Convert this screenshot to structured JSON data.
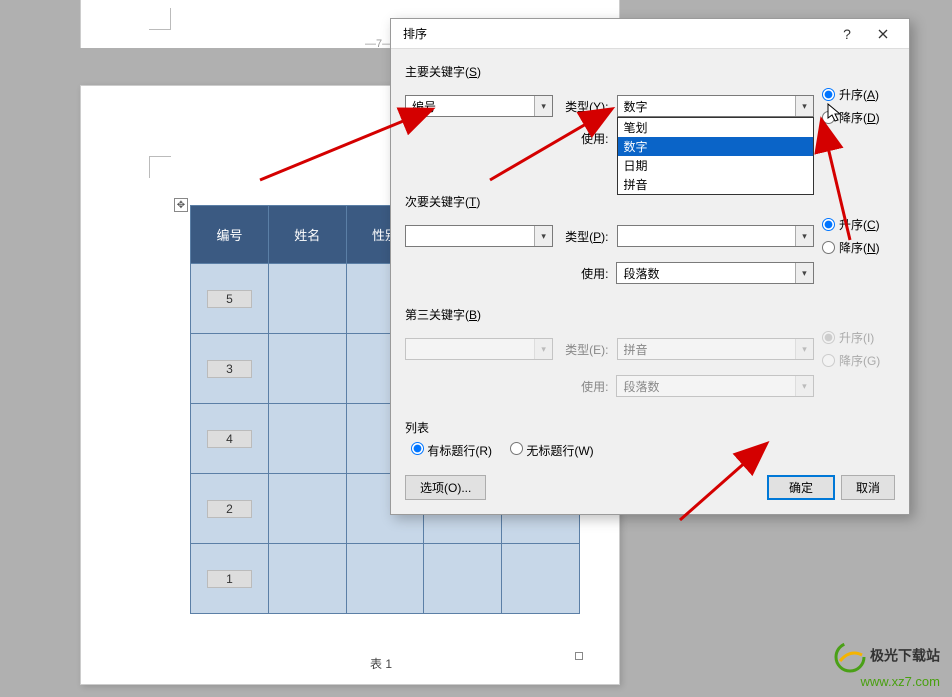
{
  "page_gap": "—7—",
  "table": {
    "headers": [
      "编号",
      "姓名",
      "性别",
      "",
      ""
    ],
    "rows": [
      [
        "5",
        "",
        "",
        "",
        ""
      ],
      [
        "3",
        "",
        "",
        "",
        ""
      ],
      [
        "4",
        "",
        "",
        "",
        ""
      ],
      [
        "2",
        "",
        "",
        "",
        ""
      ],
      [
        "1",
        "",
        "",
        "",
        ""
      ]
    ],
    "caption": "表 1"
  },
  "dialog": {
    "title": "排序",
    "section1": {
      "label_prefix": "主要关键字(",
      "label_hotkey": "S",
      "label_suffix": ")",
      "key_value": "编号",
      "type_label_prefix": "类型(",
      "type_hotkey": "Y",
      "type_label_suffix": "):",
      "type_value": "数字",
      "type_options": [
        "笔划",
        "数字",
        "日期",
        "拼音"
      ],
      "use_label": "使用:",
      "asc_label": "升序(A)",
      "desc_label": "降序(D)"
    },
    "section2": {
      "label_prefix": "次要关键字(",
      "label_hotkey": "T",
      "label_suffix": ")",
      "key_value": "",
      "type_label_prefix": "类型(",
      "type_hotkey": "P",
      "type_label_suffix": "):",
      "type_value": "",
      "use_label": "使用:",
      "use_value": "段落数",
      "asc_label": "升序(C)",
      "desc_label": "降序(N)"
    },
    "section3": {
      "label_prefix": "第三关键字(",
      "label_hotkey": "B",
      "label_suffix": ")",
      "key_value": "",
      "type_label": "类型(E):",
      "type_value": "拼音",
      "use_label": "使用:",
      "use_value": "段落数",
      "asc_label": "升序(I)",
      "desc_label": "降序(G)"
    },
    "list": {
      "label": "列表",
      "has_header": "有标题行(R)",
      "no_header": "无标题行(W)"
    },
    "options_btn": "选项(O)...",
    "ok_btn": "确定",
    "cancel_btn": "取消"
  },
  "logo": {
    "cn": "极光下载站",
    "url": "www.xz7.com"
  }
}
